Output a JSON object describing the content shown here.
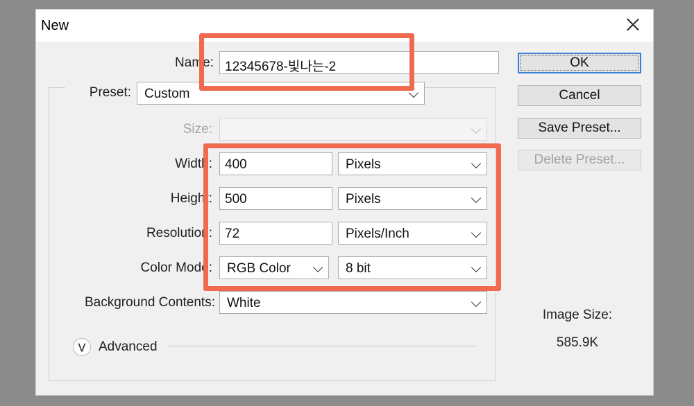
{
  "window": {
    "title": "New"
  },
  "form": {
    "name_label": "Name:",
    "name_value": "12345678-빛나는-2",
    "preset_label": "Preset:",
    "preset_value": "Custom",
    "size_label": "Size:",
    "size_value": "",
    "width_label": "Width:",
    "width_value": "400",
    "width_unit": "Pixels",
    "height_label": "Height:",
    "height_value": "500",
    "height_unit": "Pixels",
    "resolution_label": "Resolution:",
    "resolution_value": "72",
    "resolution_unit": "Pixels/Inch",
    "color_mode_label": "Color Mode:",
    "color_mode_value": "RGB Color",
    "bit_depth_value": "8 bit",
    "background_label": "Background Contents:",
    "background_value": "White",
    "advanced_label": "Advanced"
  },
  "buttons": {
    "ok": "OK",
    "cancel": "Cancel",
    "save_preset": "Save Preset...",
    "delete_preset": "Delete Preset..."
  },
  "info": {
    "image_size_label": "Image Size:",
    "image_size_value": "585.9K"
  },
  "icons": {
    "close": "close-icon",
    "dropdown": "chevron-down-icon",
    "advanced": "double-chevron-down-icon"
  },
  "colors": {
    "highlight": "#ef6a4e",
    "default_button_border": "#3a7fd5"
  }
}
